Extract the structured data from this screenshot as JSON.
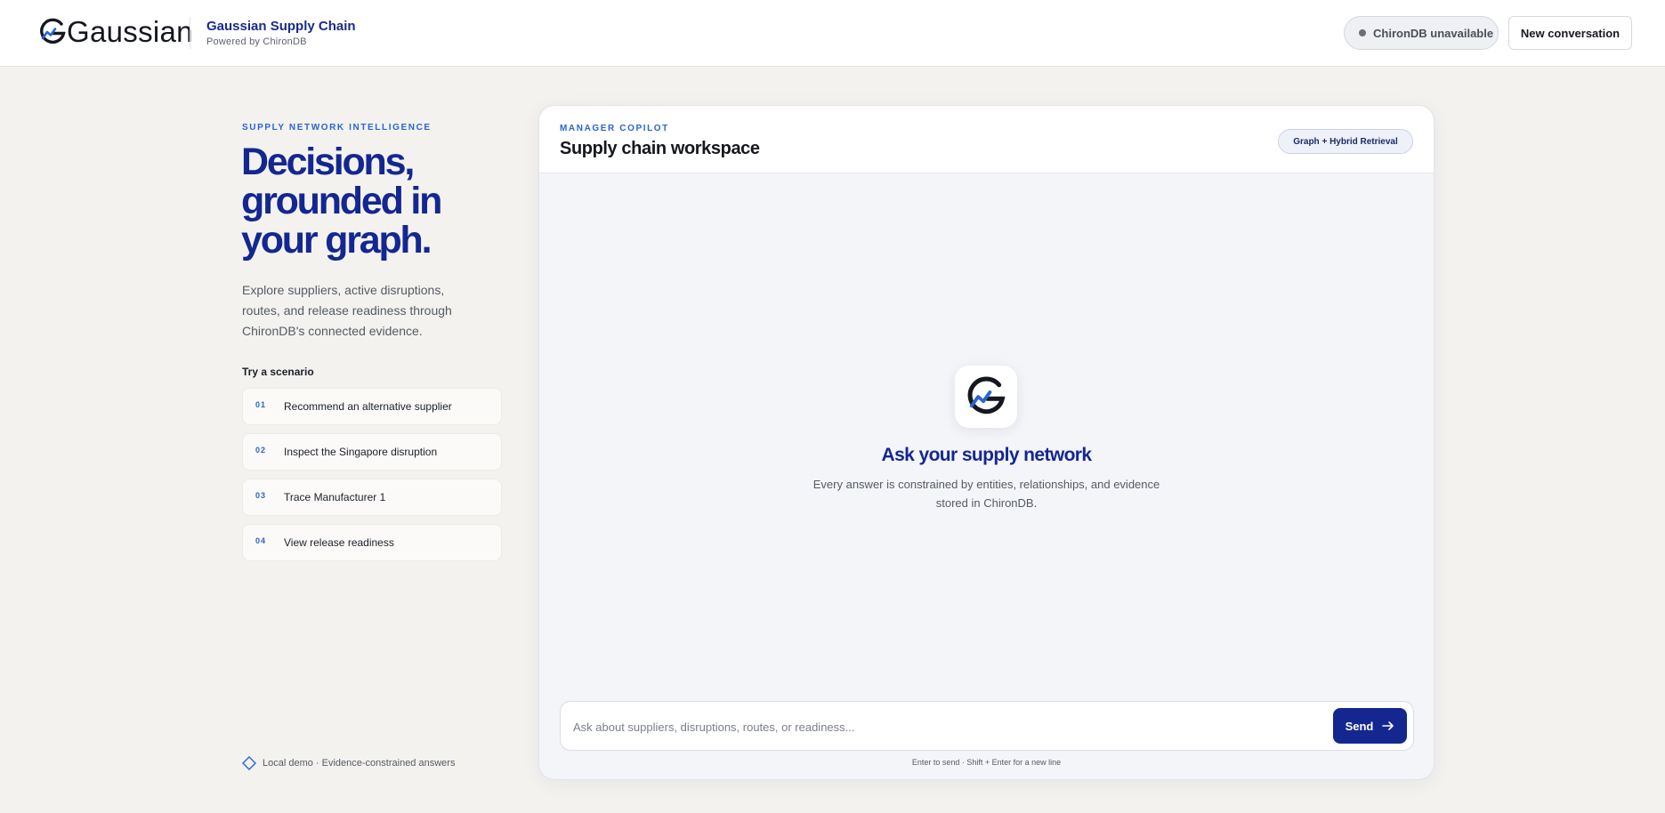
{
  "header": {
    "logo_text": "Gaussian",
    "brand_title": "Gaussian Supply Chain",
    "brand_sub": "Powered by ChironDB",
    "status_label": "ChironDB unavailable",
    "new_conversation_label": "New conversation"
  },
  "intro": {
    "eyebrow": "SUPPLY NETWORK INTELLIGENCE",
    "headline_lines": [
      "Decisions,",
      "grounded in",
      "your graph."
    ],
    "lead": "Explore suppliers, active disruptions, routes, and release readiness through ChironDB's connected evidence.",
    "scenarios_label": "Try a scenario",
    "scenarios": [
      {
        "num": "01",
        "label": "Recommend an alternative supplier"
      },
      {
        "num": "02",
        "label": "Inspect the Singapore disruption"
      },
      {
        "num": "03",
        "label": "Trace Manufacturer 1"
      },
      {
        "num": "04",
        "label": "View release readiness"
      }
    ],
    "footer": "Local demo · Evidence-constrained answers"
  },
  "workspace": {
    "eyebrow": "MANAGER COPILOT",
    "title": "Supply chain workspace",
    "badge": "Graph + Hybrid Retrieval",
    "empty_title": "Ask your supply network",
    "empty_desc": "Every answer is constrained by entities, relationships, and evidence stored in ChironDB.",
    "input_placeholder": "Ask about suppliers, disruptions, routes, or readiness...",
    "send_label": "Send",
    "hint": "Enter to send · Shift + Enter for a new line"
  },
  "icons": {
    "logo": "gaussian-g-logo-icon",
    "status": "status-dot-icon",
    "footer": "diamond-icon",
    "send": "arrow-right-icon",
    "empty_state": "gaussian-g-logo-icon"
  },
  "colors": {
    "brand_navy": "#142791",
    "accent_blue": "#2a64d6",
    "page_bg": "#f3f2ef",
    "panel_bg": "#f4f5f8"
  }
}
